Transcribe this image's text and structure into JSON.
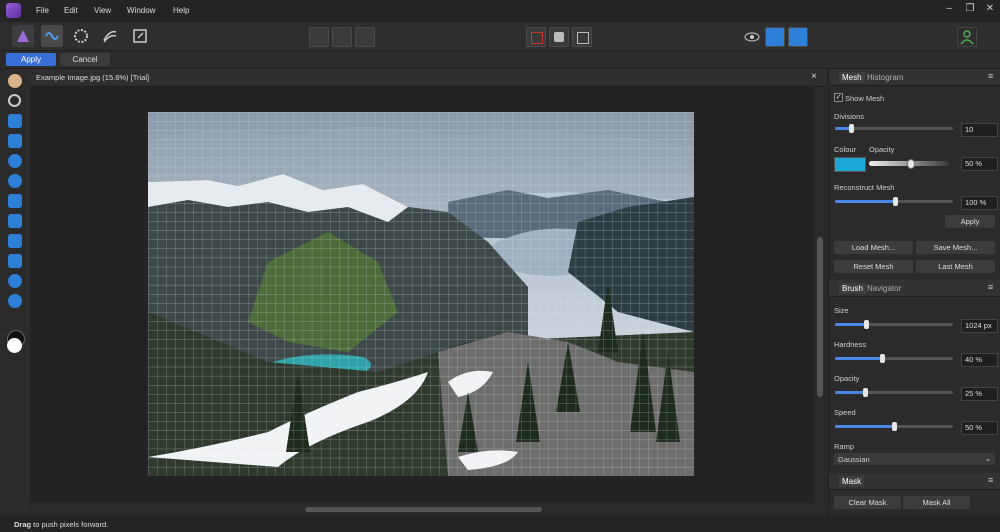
{
  "menu": [
    "File",
    "Edit",
    "View",
    "Window",
    "Help"
  ],
  "context": {
    "apply": "Apply",
    "cancel": "Cancel"
  },
  "document": {
    "title": "Example Image.jpg (15.6%) [Trial]",
    "close": "×"
  },
  "status": {
    "bold": "Drag",
    "rest": " to push pixels forward."
  },
  "panel1": {
    "tabs": [
      "Mesh",
      "Histogram"
    ],
    "show_mesh": "Show Mesh",
    "divisions_label": "Divisions",
    "divisions_value": "10",
    "colour_label": "Colour",
    "opacity_label": "Opacity",
    "opacity_value": "50 %",
    "colour": "#1ea7d9",
    "reconstruct_label": "Reconstruct Mesh",
    "reconstruct_value": "100 %",
    "apply": "Apply",
    "load": "Load Mesh...",
    "save": "Save Mesh...",
    "reset": "Reset Mesh",
    "last": "Last Mesh"
  },
  "panel2": {
    "tabs": [
      "Brush",
      "Navigator"
    ],
    "size_label": "Size",
    "size_value": "1024 px",
    "hardness_label": "Hardness",
    "hardness_value": "40 %",
    "opacity_label": "Opacity",
    "opacity_value": "25 %",
    "speed_label": "Speed",
    "speed_value": "50 %",
    "ramp_label": "Ramp",
    "ramp_value": "Gaussian"
  },
  "panel3": {
    "tab": "Mask",
    "clear": "Clear Mask",
    "all": "Mask All"
  },
  "accent": "#3a6fd8"
}
